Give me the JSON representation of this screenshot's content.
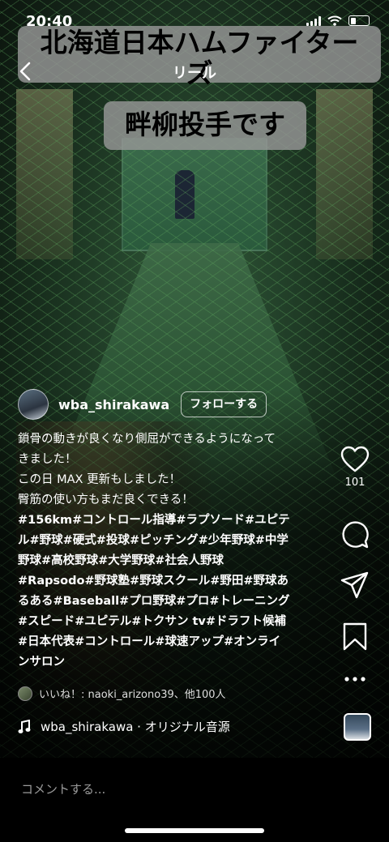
{
  "status_bar": {
    "time": "20:40"
  },
  "header": {
    "title": "リール"
  },
  "overlay": {
    "line1": "北海道日本ハムファイター",
    "line1b": "ズ",
    "line2": "畔柳投手です"
  },
  "post": {
    "username": "wba_shirakawa",
    "follow_label": "フォローする",
    "caption_lines": [
      "鎖骨の動きが良くなり側屈ができるようになって",
      "きました！",
      "この日 MAX 更新もしました！",
      "臀筋の使い方もまだ良くできる！"
    ],
    "hashtag_lines": [
      "#156km#コントロール指導#ラプソード#ユピテ",
      "ル#野球#硬式#投球#ピッチング#少年野球#中学",
      "野球#高校野球#大学野球#社会人野球",
      "#Rapsodo#野球塾#野球スクール#野田#野球あ",
      "るある#Baseball#プロ野球#プロ#トレーニング",
      "#スピード#ユピテル#トクサン tv#ドラフト候補",
      "#日本代表#コントロール#球速アップ#オンライ",
      "ンサロン"
    ],
    "likes_text": "いいね！: naoki_arizono39、他100人",
    "audio_text": "wba_shirakawa · オリジナル音源"
  },
  "actions": {
    "like_count": "101"
  },
  "comment": {
    "placeholder": "コメントする..."
  },
  "icons": [
    "chevron-left-icon",
    "heart-icon",
    "comment-icon",
    "send-icon",
    "bookmark-icon",
    "more-icon",
    "music-note-icon",
    "signal-icon",
    "wifi-icon",
    "battery-icon"
  ]
}
